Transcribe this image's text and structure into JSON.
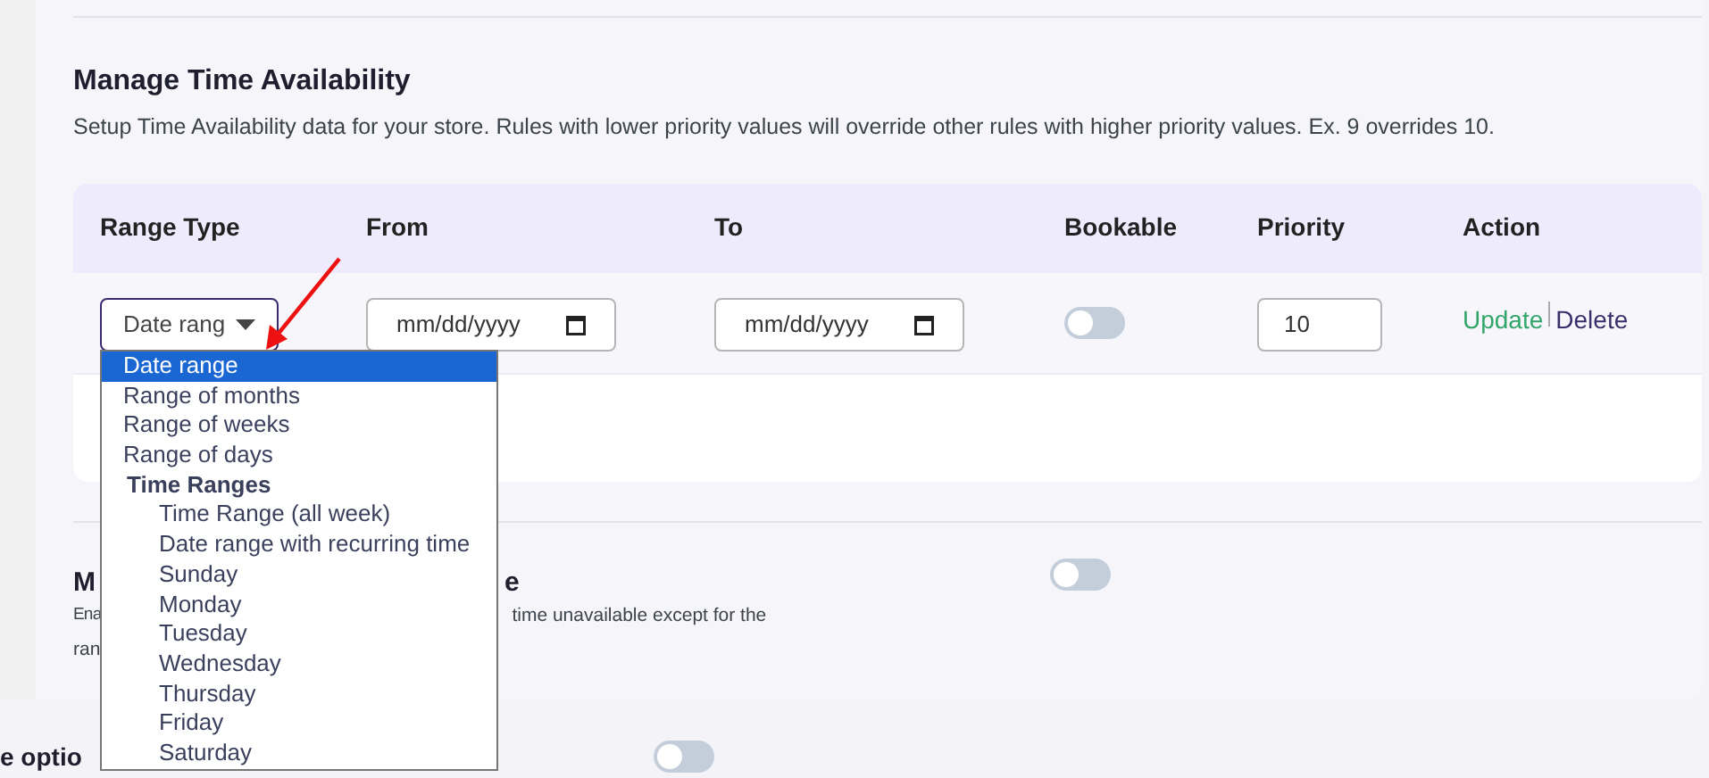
{
  "section": {
    "title": "Manage Time Availability",
    "description": "Setup Time Availability data for your store. Rules with lower priority values will override other rules with higher priority values. Ex. 9 overrides 10."
  },
  "table": {
    "columns": [
      "Range Type",
      "From",
      "To",
      "Bookable",
      "Priority",
      "Action"
    ],
    "rows": [
      {
        "range_type": "Date rang",
        "from": {
          "placeholder": "mm/dd/yyyy"
        },
        "to": {
          "placeholder": "mm/dd/yyyy"
        },
        "bookable": false,
        "priority": "10",
        "actions": [
          {
            "label": "Update",
            "kind": "update"
          },
          {
            "label": "Delete",
            "kind": "delete"
          }
        ]
      }
    ]
  },
  "dropdown": {
    "options": [
      {
        "label": "Date range",
        "kind": "option",
        "selected": true
      },
      {
        "label": "Range of months",
        "kind": "option",
        "selected": false
      },
      {
        "label": "Range of weeks",
        "kind": "option",
        "selected": false
      },
      {
        "label": "Range of days",
        "kind": "option",
        "selected": false
      },
      {
        "label": "Time Ranges",
        "kind": "group"
      },
      {
        "label": "Time Range (all week)",
        "kind": "suboption",
        "selected": false
      },
      {
        "label": "Date range with recurring time",
        "kind": "suboption",
        "selected": false
      },
      {
        "label": "Sunday",
        "kind": "suboption",
        "selected": false
      },
      {
        "label": "Monday",
        "kind": "suboption",
        "selected": false
      },
      {
        "label": "Tuesday",
        "kind": "suboption",
        "selected": false
      },
      {
        "label": "Wednesday",
        "kind": "suboption",
        "selected": false
      },
      {
        "label": "Thursday",
        "kind": "suboption",
        "selected": false
      },
      {
        "label": "Friday",
        "kind": "suboption",
        "selected": false
      },
      {
        "label": "Saturday",
        "kind": "suboption",
        "selected": false
      }
    ]
  },
  "section2": {
    "title_fragments": [
      "M",
      "e"
    ],
    "description_fragments": [
      "Ena",
      "time unavailable except for the",
      "ran"
    ],
    "on": false
  },
  "bottom_setting": {
    "label": "e optio",
    "on": false
  }
}
